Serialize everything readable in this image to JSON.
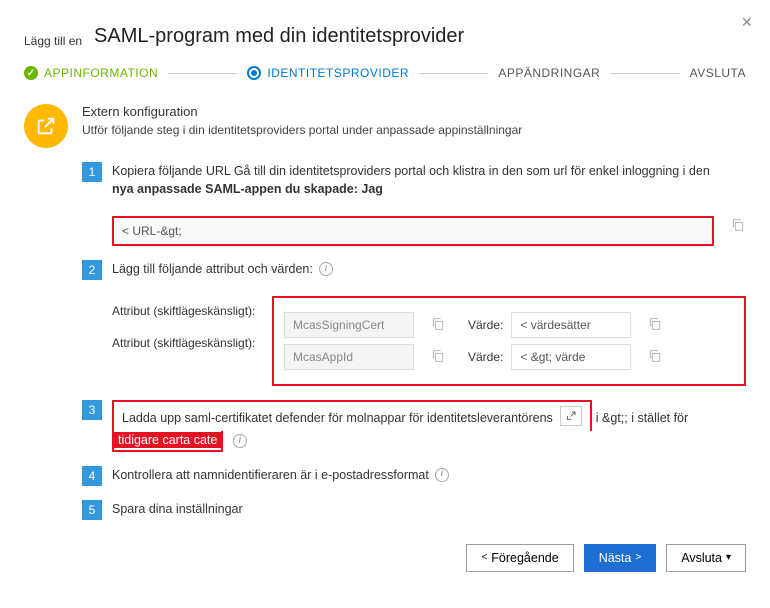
{
  "header": {
    "prefix": "Lägg till en",
    "title": "SAML-program med din identitetsprovider"
  },
  "stepper": {
    "s1": "APPINFORMATION",
    "s2": "IDENTITETSPROVIDER",
    "s3": "APPÄNDRINGAR",
    "s4": "AVSLUTA"
  },
  "extern": {
    "title": "Extern konfiguration",
    "sub": "Utför följande steg i din identitetsproviders portal under anpassade appinställningar"
  },
  "num": {
    "n1": "1",
    "n2": "2",
    "n3": "3",
    "n4": "4",
    "n5": "5"
  },
  "step1": {
    "line1": "Kopiera följande URL Gå till din identitetsproviders portal och klistra in den som url för enkel inloggning i den",
    "line2": "nya anpassade SAML-appen du skapade: Jag",
    "url": "< URL-&gt;"
  },
  "step2": {
    "text": "Lägg till följande attribut och värden:",
    "attr_label": "Attribut (skiftlägeskänsligt):",
    "value_label": "Värde:",
    "a1_name": "McasSigningCert",
    "a1_value": "< värdesätter",
    "a2_name": "McasAppId",
    "a2_value": "< &gt; värde"
  },
  "step3": {
    "part_a": "Ladda upp saml-certifikatet defender för molnappar för identitetsleverantörens",
    "part_b": "i &gt;; i stället för",
    "highlight": "tidigare carta cate"
  },
  "step4": {
    "text": "Kontrollera att namnidentifieraren är i e-postadressformat"
  },
  "step5": {
    "text": "Spara dina inställningar"
  },
  "footer": {
    "prev": "Föregående",
    "next": "Nästa",
    "end": "Avsluta"
  }
}
